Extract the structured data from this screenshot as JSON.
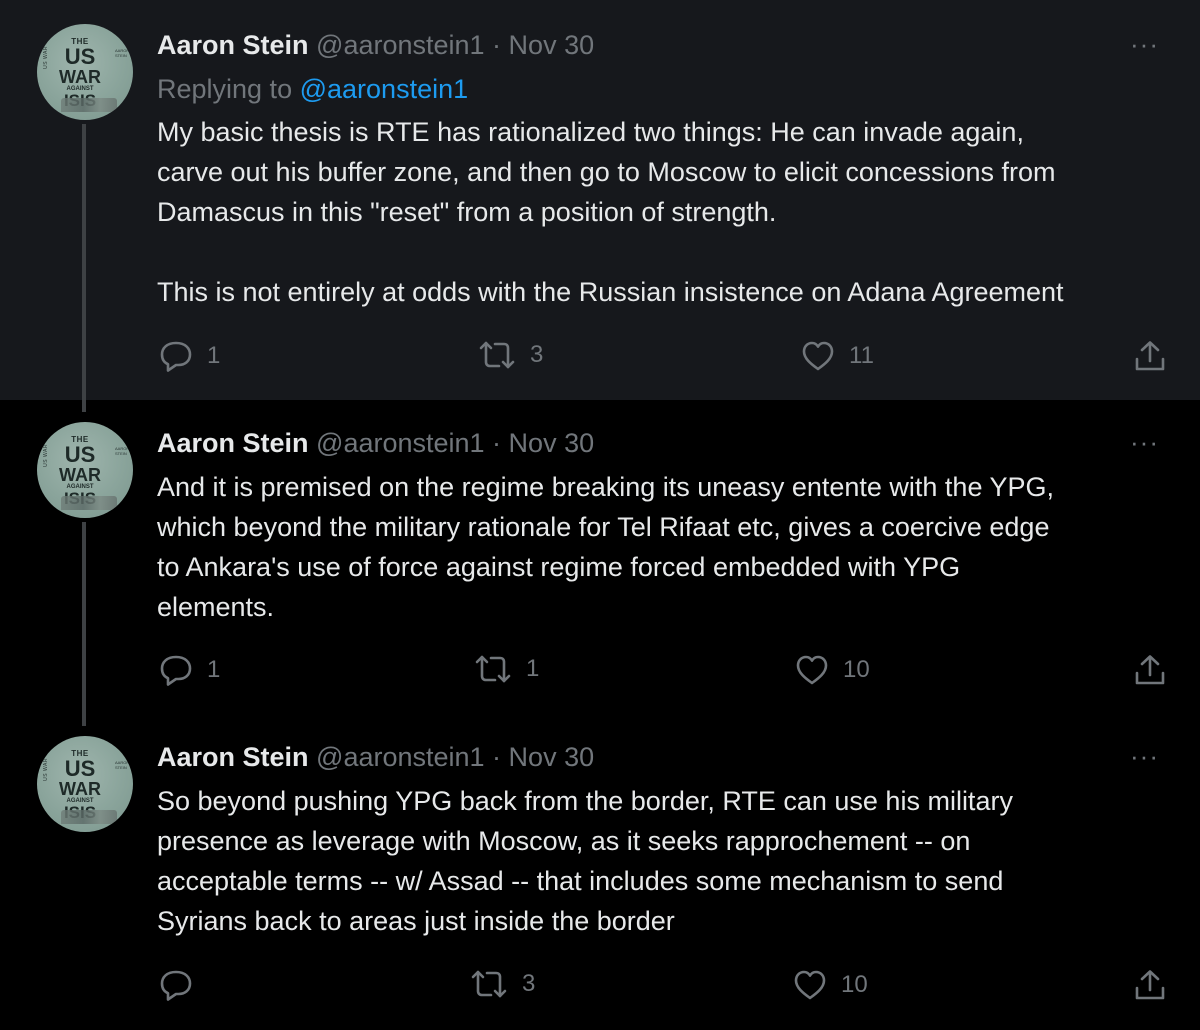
{
  "thread": {
    "tweets": [
      {
        "author_name": "Aaron Stein",
        "handle_date": "@aaronstein1 · Nov 30",
        "more": "···",
        "replying_label": "Replying to",
        "replying_handle": "@aaronstein1",
        "lines": [
          "My basic thesis is RTE has rationalized two things: He can invade again,",
          "carve out his buffer zone, and then go to Moscow to elicit concessions from",
          "Damascus in this \"reset\" from a position of strength.",
          "This is not entirely at odds with the Russian insistence on Adana Agreement"
        ],
        "replies": "1",
        "retweets": "3",
        "likes": "11"
      },
      {
        "author_name": "Aaron Stein",
        "handle_date": "@aaronstein1 · Nov 30",
        "more": "···",
        "lines": [
          "And it is premised on the regime breaking its uneasy entente with the YPG,",
          "which beyond the military rationale for Tel Rifaat etc, gives a coercive edge",
          "to Ankara's use of force against regime forced embedded with YPG",
          "elements."
        ],
        "replies": "1",
        "retweets": "1",
        "likes": "10"
      },
      {
        "author_name": "Aaron Stein",
        "handle_date": "@aaronstein1 · Nov 30",
        "more": "···",
        "lines": [
          "So beyond pushing YPG back from the border, RTE can use his military",
          "presence as leverage with Moscow, as it seeks rapprochement -- on",
          "acceptable terms -- w/ Assad -- that includes some mechanism to send",
          "Syrians back to areas just inside the border"
        ],
        "replies": "",
        "retweets": "3",
        "likes": "10"
      }
    ]
  },
  "avatar": {
    "the": "THE",
    "us": "US",
    "war": "WAR",
    "against": "AGAINST",
    "isis": "ISIS",
    "side": "US WAR",
    "right": "AARON STEIN"
  },
  "icons": {
    "reply": "reply-icon",
    "retweet": "retweet-icon",
    "like": "like-icon",
    "share": "share-icon"
  },
  "colors": {
    "background": "#000000",
    "highlight_background": "#16181c",
    "text": "#e7e9ea",
    "muted": "#71767b",
    "link": "#1d9bf0"
  }
}
